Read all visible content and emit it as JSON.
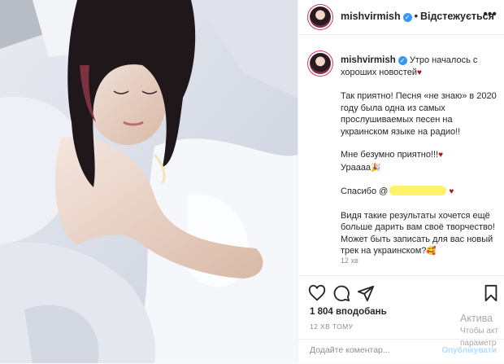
{
  "header": {
    "username": "mishvirmish",
    "separator": "•",
    "follow_state": "Відстежується",
    "more_icon": "more-horizontal-icon"
  },
  "caption": {
    "username": "mishvirmish",
    "paragraphs": [
      "Утро началось с хороших новостей",
      "Так приятно! Песня «не знаю» в 2020 году была одна из самых прослушиваемых песен на украинском языке на радио!!",
      "Мне безумно приятно!!!",
      "Ураааа",
      "Спасибо @",
      "Видя такие результаты хочется ещё больше дарить вам своё творчество! Может быть записать для вас новый трек на украинском?"
    ],
    "emojis": {
      "heart": "♥",
      "party": "🎉",
      "smile": "🥰"
    },
    "time": "12 хв"
  },
  "actions": {
    "icons": [
      "heart-outline-icon",
      "comment-icon",
      "share-icon",
      "bookmark-icon"
    ]
  },
  "likes": "1 804 вподобань",
  "post_time": "12 ХВ ТОМУ",
  "comment": {
    "placeholder": "Додайте коментар...",
    "publish": "Опублікувати"
  },
  "watermark": {
    "line1": "Актива",
    "line2": "Чтобы акт",
    "line3": "параметр"
  },
  "colors": {
    "verified": "#3897f0",
    "heart": "#b0121d",
    "redaction": "#fff36b",
    "publish": "#b3dbff",
    "muted": "#8e8e8e"
  }
}
